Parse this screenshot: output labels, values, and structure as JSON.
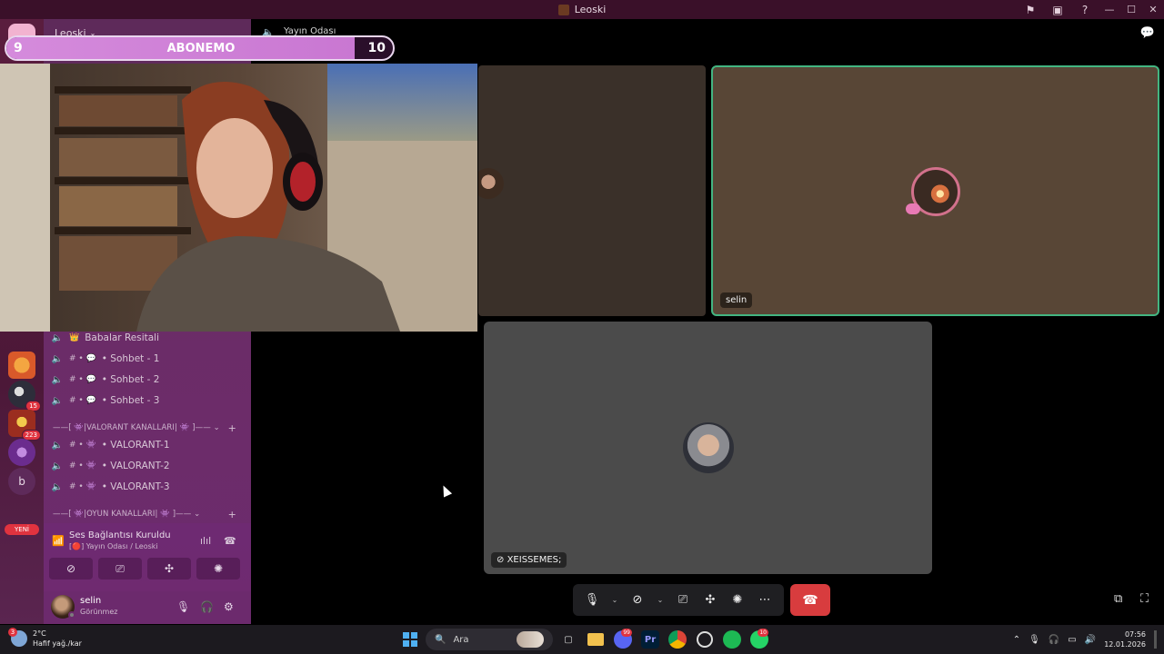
{
  "window": {
    "title": "Leoski"
  },
  "server_header": {
    "name": "Leoski",
    "voice_channel_title": "Yayın Odası"
  },
  "sub_goal": {
    "label": "ABONEMO",
    "current": "9",
    "target": "10",
    "progress": 0.9
  },
  "servers": [
    {
      "name": "server-1",
      "badge": ""
    },
    {
      "name": "server-2",
      "badge": "15"
    },
    {
      "name": "server-3",
      "badge": "223"
    },
    {
      "name": "server-4",
      "badge": ""
    },
    {
      "name": "server-5",
      "letter": "b",
      "badge": ""
    }
  ],
  "new_badge": "YENİ",
  "channels": [
    {
      "name": "Babalar Resitali",
      "prefix": "👑",
      "type": "voice"
    },
    {
      "name": "• Sohbet - 1",
      "prefix": "# • 💬",
      "type": "voice"
    },
    {
      "name": "• Sohbet - 2",
      "prefix": "# • 💬",
      "type": "voice"
    },
    {
      "name": "• Sohbet - 3",
      "prefix": "# • 💬",
      "type": "voice"
    },
    {
      "name": "• VALORANT-1",
      "prefix": "# • 👾",
      "type": "voice"
    },
    {
      "name": "• VALORANT-2",
      "prefix": "# • 👾",
      "type": "voice"
    },
    {
      "name": "• VALORANT-3",
      "prefix": "# • 👾",
      "type": "voice"
    }
  ],
  "categories": [
    {
      "name": "——[ 👾|VALORANT KANALLARI| 👾 ]—— ⌄"
    },
    {
      "name": "——[ 👾|OYUN KANALLARI| 👾 ]—— ⌄"
    }
  ],
  "voice_connection": {
    "status": "Ses Bağlantısı Kuruldu",
    "channel": "[🔴] Yayın Odası / Leoski"
  },
  "user": {
    "name": "selin",
    "status": "Görünmez"
  },
  "participants": [
    {
      "name": "selin",
      "speaking": true
    },
    {
      "name": "XEISSEMES;",
      "camera_off": true
    }
  ],
  "taskbar": {
    "weather_temp": "2°C",
    "weather_desc": "Hafif yağ./kar",
    "weather_badge": "3",
    "search_placeholder": "Ara",
    "discord_badge": "99",
    "whatsapp_badge": "10",
    "time": "07:56",
    "date": "12.01.2026"
  },
  "colors": {
    "accent_green": "#43b581",
    "end_call": "#d83c3e",
    "sidebar": "#6b2c67"
  }
}
